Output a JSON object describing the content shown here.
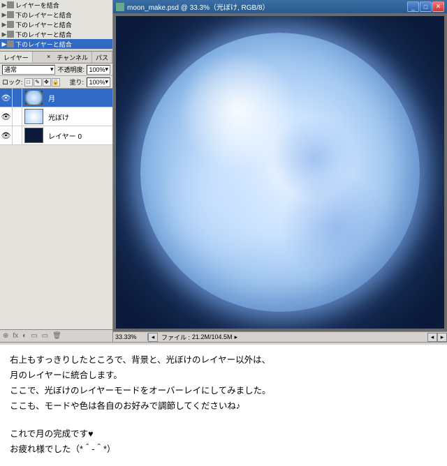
{
  "merge_menu": {
    "items": [
      {
        "label": "レイヤーを結合",
        "selected": false
      },
      {
        "label": "下のレイヤーと結合",
        "selected": false
      },
      {
        "label": "下のレイヤーと結合",
        "selected": false
      },
      {
        "label": "下のレイヤーと結合",
        "selected": false
      },
      {
        "label": "下のレイヤーと結合",
        "selected": true
      }
    ]
  },
  "layers_panel": {
    "tabs": {
      "layers": "レイヤー",
      "channels": "チャンネル",
      "paths": "パス"
    },
    "close_x": "×",
    "blend_mode": "通常",
    "dropdown_arrow": "▾",
    "opacity_label": "不透明度:",
    "opacity_value": "100%",
    "lock_label": "ロック:",
    "fill_label": "塗り:",
    "fill_value": "100%",
    "lock_glyphs": {
      "a": "□",
      "b": "✎",
      "c": "✥",
      "d": "🔒"
    },
    "layers": [
      {
        "name": "月",
        "thumb": "#a3c8f0",
        "selected": true
      },
      {
        "name": "光ぼけ",
        "thumb": "#cfe4fb",
        "selected": false
      },
      {
        "name": "レイヤー 0",
        "thumb": "#0b1a3a",
        "selected": false
      }
    ],
    "eye_glyph": "👁",
    "footer_glyphs": {
      "a": "⊕",
      "b": "⟳",
      "c": "fx",
      "d": "◐",
      "e": "▭",
      "f": "🗑"
    }
  },
  "document": {
    "title": "moon_make.psd @ 33.3%（光ぼけ, RGB/8）",
    "win": {
      "min": "_",
      "max": "□",
      "close": "✕"
    },
    "zoom": "33.33%",
    "file_info_label": "ファイル :",
    "file_info_value": "21.2M/104.5M",
    "scroll": {
      "left": "◂",
      "right": "▸",
      "down": "▾"
    },
    "info_arrow": "▸"
  },
  "instructions": {
    "l1": "右上もすっきりしたところで、背景と、光ぼけのレイヤー以外は、",
    "l2": "月のレイヤーに統合します。",
    "l3": "ここで、光ぼけのレイヤーモードをオーバーレイにしてみました。",
    "l4": "ここも、モードや色は各自のお好みで調節してくださいね♪",
    "l5": "これで月の完成です♥",
    "l6": "お疲れ様でした（*＾-＾*）"
  }
}
